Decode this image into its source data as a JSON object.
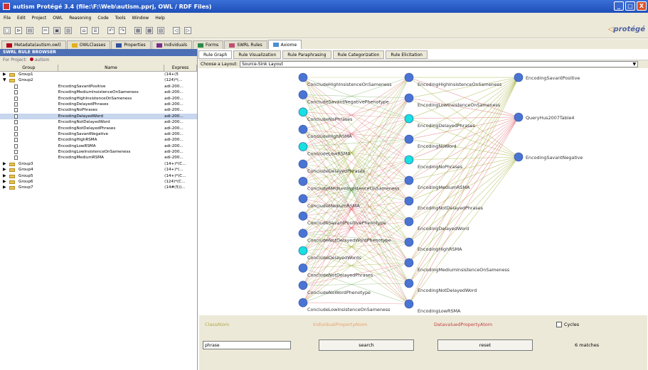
{
  "window": {
    "title": "autism  Protégé 3.4    (file:\\F:\\Web\\autism.pprj, OWL / RDF Files)",
    "controls": [
      "_",
      "□",
      "X"
    ]
  },
  "menu": [
    "File",
    "Edit",
    "Project",
    "OWL",
    "Reasoning",
    "Code",
    "Tools",
    "Window",
    "Help"
  ],
  "toolbar": {
    "icons": [
      "new-icon",
      "open-icon",
      "save-icon",
      "cut-icon",
      "copy-icon",
      "paste-icon",
      "find-icon",
      "find-next-icon",
      "undo-icon",
      "redo-icon",
      "widget-a-icon",
      "widget-b-icon",
      "widget-c-icon",
      "back-icon",
      "forward-icon"
    ],
    "glyphs": [
      "□",
      "⊳",
      "▤",
      "✂",
      "▣",
      "▥",
      "⌂",
      "⌸",
      "↶",
      "↷",
      "▦",
      "▩",
      "▧",
      "◁",
      "▷"
    ],
    "logo": "protégé"
  },
  "main_tabs": [
    {
      "label": "Metadata(autism.owl)",
      "color": "#b3001b"
    },
    {
      "label": "OWLClasses",
      "color": "#e0b020"
    },
    {
      "label": "Properties",
      "color": "#3050a0"
    },
    {
      "label": "Individuals",
      "color": "#7a2a8a"
    },
    {
      "label": "Forms",
      "color": "#2a8a4a"
    },
    {
      "label": "SWRL Rules",
      "color": "#c05070"
    },
    {
      "label": "Axiome",
      "color": "#4a90d0"
    }
  ],
  "rule_browser": {
    "title": "SWRL RULE BROWSER",
    "project_label": "For Project:",
    "project_name": "autism",
    "columns": [
      "Group",
      "Name",
      "Express"
    ],
    "rows": [
      {
        "kind": "group",
        "expanded": false,
        "group": "Group1",
        "name": "",
        "expr": "(14+(5"
      },
      {
        "kind": "group",
        "expanded": true,
        "group": "Group2",
        "name": "",
        "expr": "(124)*(..."
      },
      {
        "kind": "rule",
        "group": "",
        "name": "EncodingSavantPositive",
        "expr": "adi-200..."
      },
      {
        "kind": "rule",
        "group": "",
        "name": "EncodingMediumInsistenceOnSameness",
        "expr": "adi-200..."
      },
      {
        "kind": "rule",
        "group": "",
        "name": "EncodingHighInsistenceOnSameness",
        "expr": "adi-200..."
      },
      {
        "kind": "rule",
        "group": "",
        "name": "EncodingDelayedPhrases",
        "expr": "adi-200..."
      },
      {
        "kind": "rule",
        "group": "",
        "name": "EncodingNoPhrases",
        "expr": "adi-200..."
      },
      {
        "kind": "rule",
        "group": "",
        "name": "EncodingDelayedWord",
        "expr": "adi-200...",
        "selected": true
      },
      {
        "kind": "rule",
        "group": "",
        "name": "EncodingNotDelayedWord",
        "expr": "adi-200..."
      },
      {
        "kind": "rule",
        "group": "",
        "name": "EncodingNotDelayedPhrases",
        "expr": "adi-200..."
      },
      {
        "kind": "rule",
        "group": "",
        "name": "EncodingSavantNegative",
        "expr": "adi-200..."
      },
      {
        "kind": "rule",
        "group": "",
        "name": "EncodingHighRSMA",
        "expr": "adi-200..."
      },
      {
        "kind": "rule",
        "group": "",
        "name": "EncodingLowRSMA",
        "expr": "adi-200..."
      },
      {
        "kind": "rule",
        "group": "",
        "name": "EncodingLowInsistenceOnSameness",
        "expr": "adi-200..."
      },
      {
        "kind": "rule",
        "group": "",
        "name": "EncodingMediumRSMA",
        "expr": "adi-200..."
      },
      {
        "kind": "group",
        "expanded": false,
        "group": "Group3",
        "name": "",
        "expr": "(14+)*(C..."
      },
      {
        "kind": "group",
        "expanded": false,
        "group": "Group4",
        "name": "",
        "expr": "(14+)*(..."
      },
      {
        "kind": "group",
        "expanded": false,
        "group": "Group5",
        "name": "",
        "expr": "(14+)*(C..."
      },
      {
        "kind": "group",
        "expanded": false,
        "group": "Group6",
        "name": "",
        "expr": "(124)*(C..."
      },
      {
        "kind": "group",
        "expanded": false,
        "group": "Group7",
        "name": "",
        "expr": "(14#(5))..."
      }
    ]
  },
  "sub_tabs": [
    "Rule Graph",
    "Rule Visualization",
    "Rule Paraphrasing",
    "Rule Categorization",
    "Rule Elicitation"
  ],
  "layout_select": {
    "label": "Choose a Layout:",
    "value": "Source-Sink Layout"
  },
  "graph": {
    "col1": [
      {
        "label": "ConcludeHighInsistenceOnSameness",
        "teal": false
      },
      {
        "label": "ConcludeSavantNegativePhenotype",
        "teal": false
      },
      {
        "label": "ConcludeNoPhrases",
        "teal": true
      },
      {
        "label": "ConcludeHighRSMA",
        "teal": false
      },
      {
        "label": "ConcludeLowRSMA",
        "teal": true
      },
      {
        "label": "ConcludeDelayedPhrases",
        "teal": false
      },
      {
        "label": "ConcludeMediumInsistenceOnSameness",
        "teal": false
      },
      {
        "label": "ConcludeMediumRSMA",
        "teal": false
      },
      {
        "label": "ConcludeSavantPositivePhenotype",
        "teal": false
      },
      {
        "label": "ConcludeNotDelayedWordPhenotype",
        "teal": false
      },
      {
        "label": "ConcludeDelayedWords",
        "teal": true
      },
      {
        "label": "ConcludeNotDelayedPhrases",
        "teal": false
      },
      {
        "label": "ConcludeNoWordPhenotype",
        "teal": false
      },
      {
        "label": "ConcludeLowInsistenceOnSameness",
        "teal": false
      }
    ],
    "col2": [
      {
        "label": "EncodingHighInsistenceOnSameness",
        "teal": false
      },
      {
        "label": "EncodingLowInsistenceOnSameness",
        "teal": false
      },
      {
        "label": "EncodingDelayedPhrases",
        "teal": true
      },
      {
        "label": "EncodingNoWord",
        "teal": false
      },
      {
        "label": "EncodingNoPhrases",
        "teal": true
      },
      {
        "label": "EncodingMediumRSMA",
        "teal": false
      },
      {
        "label": "EncodingNotDelayedPhrases",
        "teal": false
      },
      {
        "label": "EncodingDelayedWord",
        "teal": false
      },
      {
        "label": "EncodingHighRSMA",
        "teal": false
      },
      {
        "label": "EncodingMediumInsistenceOnSameness",
        "teal": false
      },
      {
        "label": "EncodingNotDelayedWord",
        "teal": false
      },
      {
        "label": "EncodingLowRSMA",
        "teal": false
      }
    ],
    "col3": [
      {
        "label": "EncodingSavantPositive"
      },
      {
        "label": "QueryHus2007Table4"
      },
      {
        "label": "EncodingSavantNegative"
      }
    ],
    "colors": {
      "node": "#4a74d4",
      "teal": "#16e0e0",
      "olive": "#9cab2c",
      "red": "#e0606a",
      "green": "#6aa84f"
    }
  },
  "bottom": {
    "legend": [
      {
        "label": "ClassAtom",
        "color": "#b3a94a"
      },
      {
        "label": "IndividualPropertyAtom",
        "color": "#e8a070"
      },
      {
        "label": "DatavaluedPropertyAtom",
        "color": "#c04040"
      }
    ],
    "cycles_label": "Cycles",
    "phrase_value": "phrase",
    "search_label": "search",
    "reset_label": "reset",
    "matches": "6 matches"
  }
}
